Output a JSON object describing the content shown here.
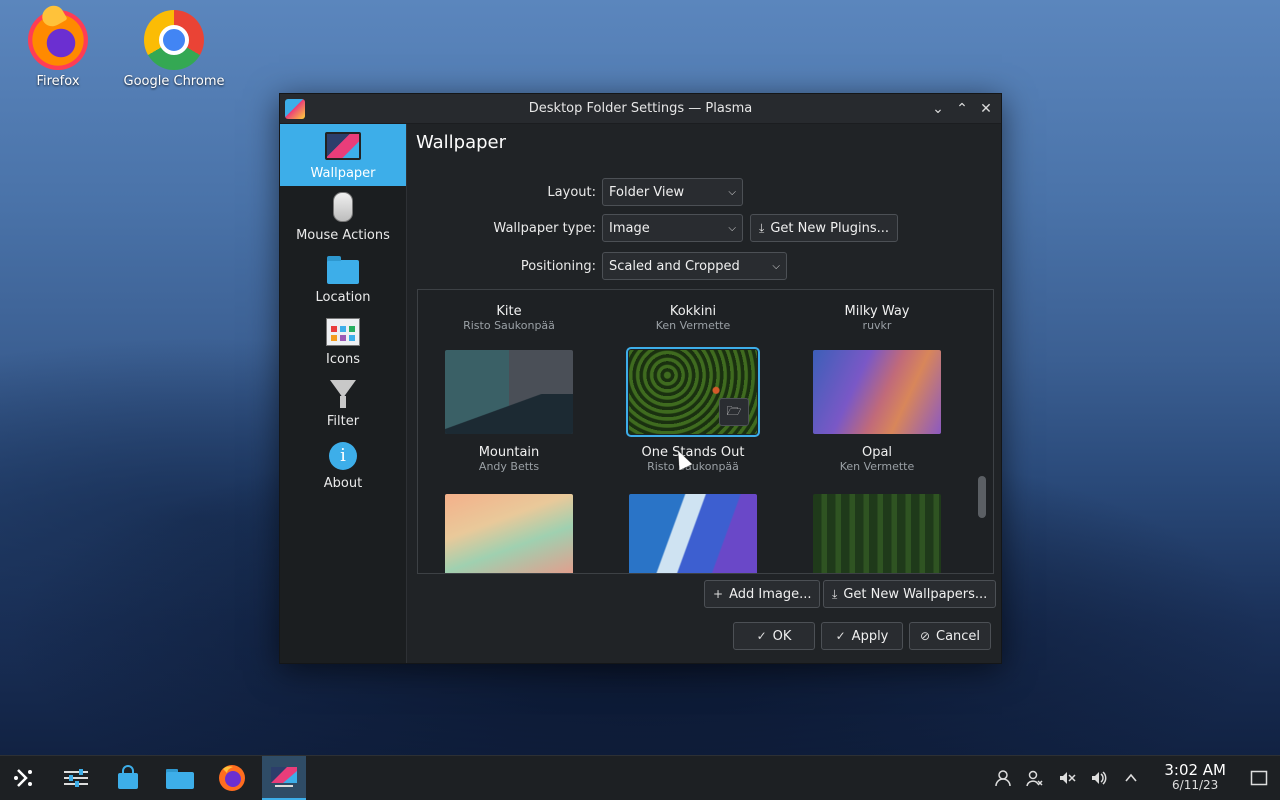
{
  "desktop": {
    "icons": [
      {
        "label": "Firefox"
      },
      {
        "label": "Google Chrome"
      }
    ]
  },
  "window": {
    "title": "Desktop Folder Settings — Plasma",
    "controls": {
      "minimize": "⌄",
      "maximize": "⌃",
      "close": "✕"
    }
  },
  "sidebar": {
    "items": [
      {
        "label": "Wallpaper",
        "icon": "wallpaper-icon",
        "selected": true
      },
      {
        "label": "Mouse Actions",
        "icon": "mouse-icon"
      },
      {
        "label": "Location",
        "icon": "folder-icon"
      },
      {
        "label": "Icons",
        "icon": "icons-icon"
      },
      {
        "label": "Filter",
        "icon": "filter-icon"
      },
      {
        "label": "About",
        "icon": "info-icon"
      }
    ]
  },
  "page": {
    "title": "Wallpaper",
    "layout_label": "Layout:",
    "layout_value": "Folder View",
    "wallpaper_type_label": "Wallpaper type:",
    "wallpaper_type_value": "Image",
    "get_plugins": "Get New Plugins...",
    "positioning_label": "Positioning:",
    "positioning_value": "Scaled and Cropped"
  },
  "wallpapers": [
    {
      "name": "Kite",
      "author": "Risto Saukonpää"
    },
    {
      "name": "Kokkini",
      "author": "Ken Vermette"
    },
    {
      "name": "Milky Way",
      "author": "ruvkr"
    },
    {
      "name": "Mountain",
      "author": "Andy Betts"
    },
    {
      "name": "One Stands Out",
      "author": "Risto Saukonpää",
      "selected": true
    },
    {
      "name": "Opal",
      "author": "Ken Vermette"
    }
  ],
  "actions": {
    "add_image": "Add Image...",
    "get_wallpapers": "Get New Wallpapers...",
    "ok": "OK",
    "apply": "Apply",
    "cancel": "Cancel"
  },
  "taskbar": {
    "clock_time": "3:02 AM",
    "clock_date": "6/11/23"
  },
  "colors": {
    "accent": "#3daee9",
    "window_bg": "#202326",
    "sidebar_bg": "#1b1e20"
  }
}
